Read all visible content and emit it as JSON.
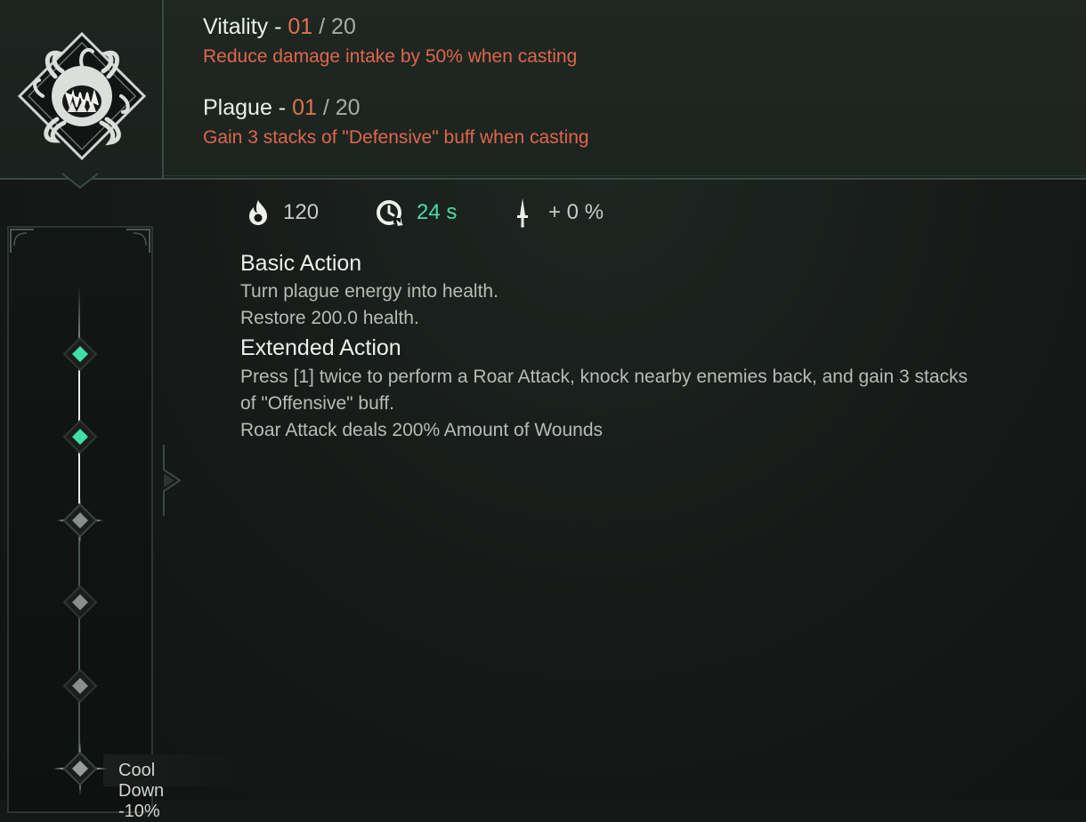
{
  "runes": [
    {
      "name": "Vitality",
      "dash": " - ",
      "level": "01",
      "max": " / 20",
      "description": "Reduce damage intake by 50% when casting"
    },
    {
      "name": "Plague",
      "dash": " - ",
      "level": "01",
      "max": " / 20",
      "description": "Gain 3 stacks of \"Defensive\" buff when casting"
    }
  ],
  "stats": {
    "energy_cost": "120",
    "cooldown": "24 s",
    "damage_bonus": "+ 0 %"
  },
  "basic_action": {
    "title": "Basic Action",
    "lines": [
      "Turn plague energy into health.",
      "Restore 200.0 health."
    ]
  },
  "extended_action": {
    "title": "Extended Action",
    "lines": [
      "Press [1] twice to perform a Roar Attack, knock nearby enemies back, and gain 3 stacks",
      "of \"Offensive\" buff.",
      "Roar Attack deals 200% Amount of Wounds"
    ]
  },
  "track": {
    "unlocked_nodes": 2,
    "total_nodes": 6,
    "bonus_label": "Cool Down -10%"
  },
  "colors": {
    "accent_level": "#e0704e",
    "rune_description": "#e0664a",
    "cooldown_value": "#4fdba8",
    "node_unlocked": "#3fe0a5",
    "node_locked": "#8a8e8b"
  },
  "icons": {
    "skill": "tentacle-maw-icon",
    "energy": "flame-icon",
    "cooldown": "clock-refresh-icon",
    "damage": "dagger-icon"
  }
}
